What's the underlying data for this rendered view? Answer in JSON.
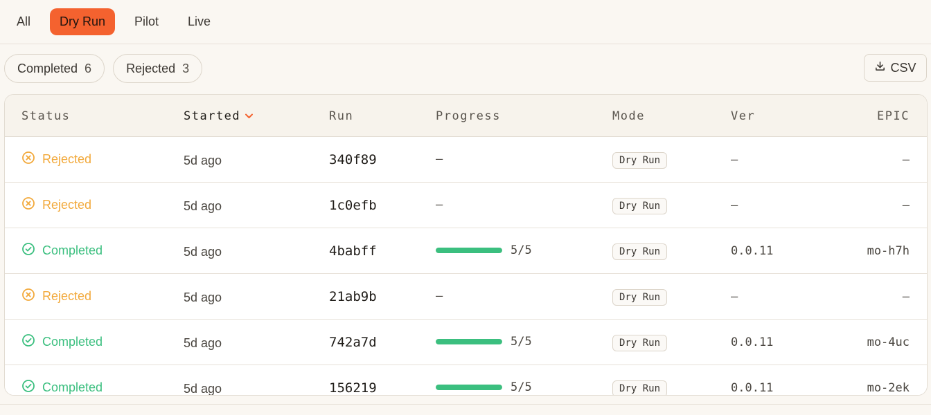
{
  "mode_tabs": [
    {
      "label": "All",
      "active": false
    },
    {
      "label": "Dry Run",
      "active": true
    },
    {
      "label": "Pilot",
      "active": false
    },
    {
      "label": "Live",
      "active": false
    }
  ],
  "filters": [
    {
      "label": "Completed",
      "count": "6"
    },
    {
      "label": "Rejected",
      "count": "3"
    }
  ],
  "csv_button": {
    "label": "CSV",
    "icon": "download-icon"
  },
  "table": {
    "headers": {
      "status": "Status",
      "started": "Started",
      "run": "Run",
      "progress": "Progress",
      "mode": "Mode",
      "ver": "Ver",
      "epic": "EPIC"
    },
    "sorted_by": "started",
    "rows": [
      {
        "status": "Rejected",
        "status_kind": "rejected",
        "started": "5d ago",
        "run": "340f89",
        "progress": "—",
        "progress_fraction": null,
        "mode": "Dry Run",
        "ver": "–",
        "epic": "–"
      },
      {
        "status": "Rejected",
        "status_kind": "rejected",
        "started": "5d ago",
        "run": "1c0efb",
        "progress": "—",
        "progress_fraction": null,
        "mode": "Dry Run",
        "ver": "–",
        "epic": "–"
      },
      {
        "status": "Completed",
        "status_kind": "completed",
        "started": "5d ago",
        "run": "4babff",
        "progress": "5/5",
        "progress_fraction": 1.0,
        "mode": "Dry Run",
        "ver": "0.0.11",
        "epic": "mo-h7h"
      },
      {
        "status": "Rejected",
        "status_kind": "rejected",
        "started": "5d ago",
        "run": "21ab9b",
        "progress": "—",
        "progress_fraction": null,
        "mode": "Dry Run",
        "ver": "–",
        "epic": "–"
      },
      {
        "status": "Completed",
        "status_kind": "completed",
        "started": "5d ago",
        "run": "742a7d",
        "progress": "5/5",
        "progress_fraction": 1.0,
        "mode": "Dry Run",
        "ver": "0.0.11",
        "epic": "mo-4uc"
      },
      {
        "status": "Completed",
        "status_kind": "completed",
        "started": "5d ago",
        "run": "156219",
        "progress": "5/5",
        "progress_fraction": 1.0,
        "mode": "Dry Run",
        "ver": "0.0.11",
        "epic": "mo-2ek"
      }
    ]
  },
  "colors": {
    "accent": "#f4622f",
    "rejected": "#f2a93b",
    "completed": "#3bbf7f"
  }
}
